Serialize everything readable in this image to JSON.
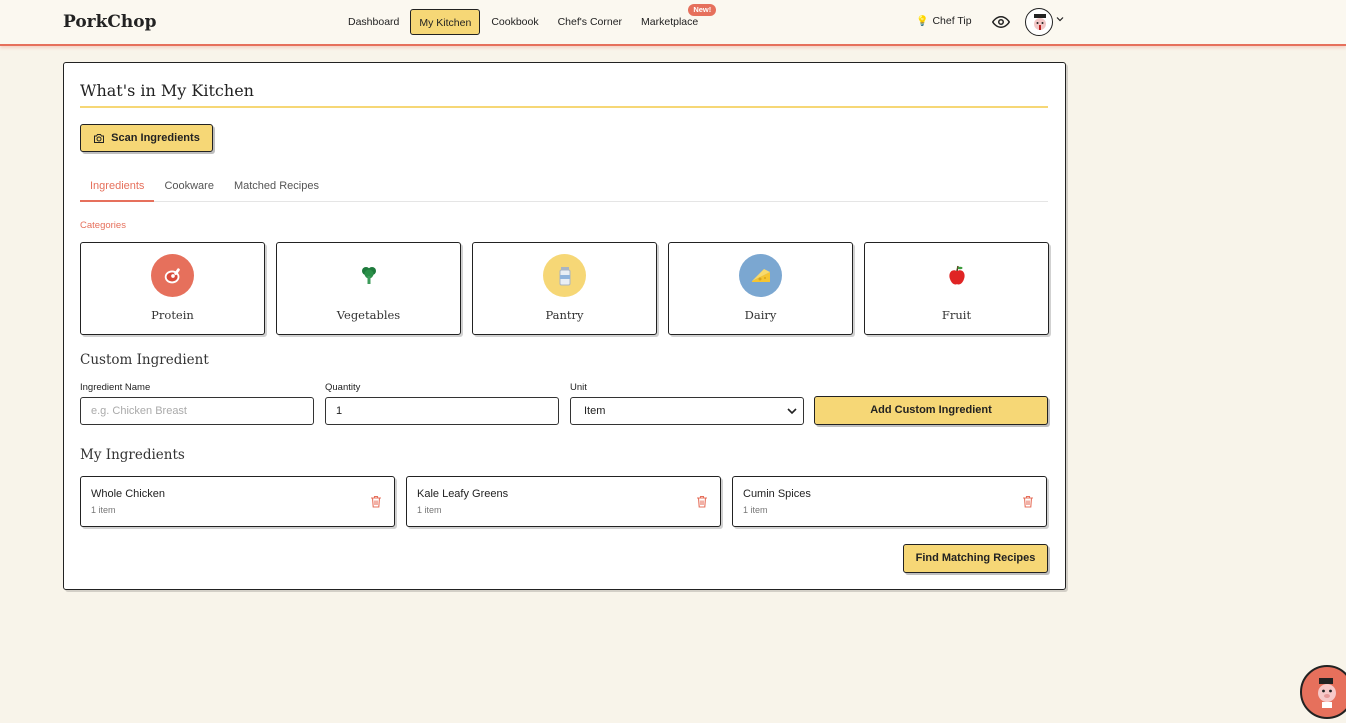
{
  "brand": "PorkChop",
  "nav": {
    "items": [
      {
        "label": "Dashboard",
        "active": false
      },
      {
        "label": "My Kitchen",
        "active": true
      },
      {
        "label": "Cookbook",
        "active": false
      },
      {
        "label": "Chef's Corner",
        "active": false
      },
      {
        "label": "Marketplace",
        "active": false,
        "badge": "New!"
      }
    ],
    "chef_tip": "Chef Tip"
  },
  "kitchen": {
    "title": "What's in My Kitchen",
    "scan_button": "Scan Ingredients",
    "tabs": [
      "Ingredients",
      "Cookware",
      "Matched Recipes"
    ],
    "active_tab": "Ingredients",
    "categories_label": "Categories",
    "categories": [
      {
        "label": "Protein",
        "icon": "meat-icon",
        "color": "#e6705c"
      },
      {
        "label": "Vegetables",
        "icon": "broccoli-icon",
        "color": "#ffffff"
      },
      {
        "label": "Pantry",
        "icon": "jar-icon",
        "color": "#f6d776"
      },
      {
        "label": "Dairy",
        "icon": "cheese-icon",
        "color": "#7ba7d1"
      },
      {
        "label": "Fruit",
        "icon": "apple-icon",
        "color": "#ffffff"
      }
    ],
    "custom": {
      "heading": "Custom Ingredient",
      "name_label": "Ingredient Name",
      "name_placeholder": "e.g. Chicken Breast",
      "quantity_label": "Quantity",
      "quantity_value": "1",
      "unit_label": "Unit",
      "unit_value": "Item",
      "add_button": "Add Custom Ingredient"
    },
    "my_ingredients_heading": "My Ingredients",
    "my_ingredients": [
      {
        "name": "Whole Chicken",
        "qty": "1 item"
      },
      {
        "name": "Kale Leafy Greens",
        "qty": "1 item"
      },
      {
        "name": "Cumin Spices",
        "qty": "1 item"
      }
    ],
    "find_button": "Find Matching Recipes"
  },
  "colors": {
    "accent": "#e6705c",
    "button": "#f6d776",
    "background": "#f8f4ea"
  }
}
